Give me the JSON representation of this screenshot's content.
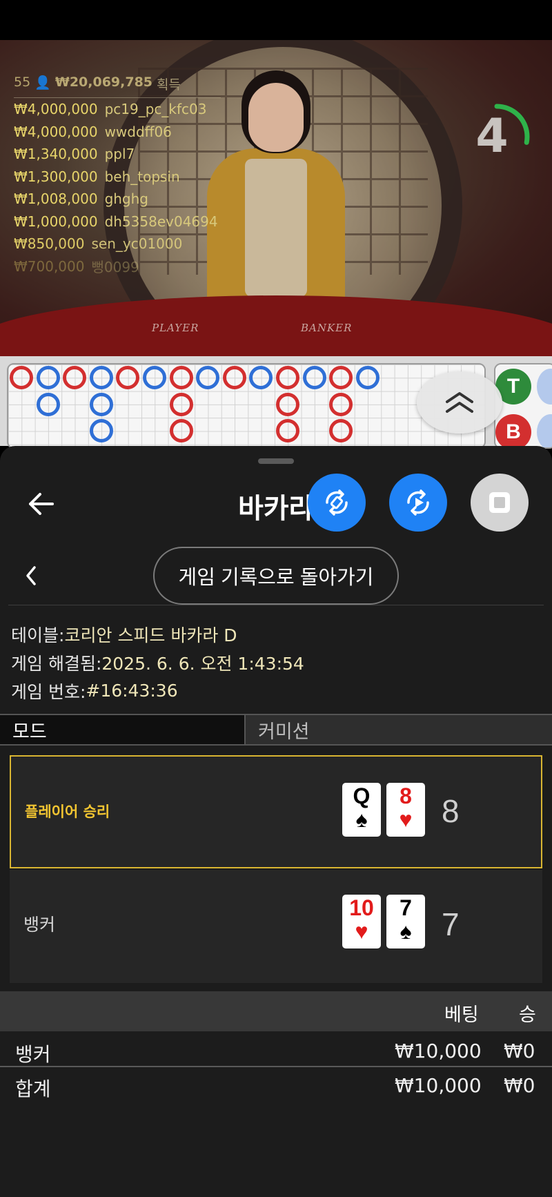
{
  "live_feed": {
    "summary_count": "55",
    "summary_amount": "₩20,069,785",
    "summary_label": "획득",
    "winners": [
      {
        "amount": "₩4,000,000",
        "name": "pc19_pc_kfc03"
      },
      {
        "amount": "₩4,000,000",
        "name": "wwddff06"
      },
      {
        "amount": "₩1,340,000",
        "name": "ppl7"
      },
      {
        "amount": "₩1,300,000",
        "name": "beh_topsin"
      },
      {
        "amount": "₩1,008,000",
        "name": "ghghg"
      },
      {
        "amount": "₩1,000,000",
        "name": "dh5358ev04694"
      },
      {
        "amount": "₩850,000",
        "name": "sen_yc01000"
      },
      {
        "amount": "₩700,000",
        "name": "뻥0099"
      }
    ]
  },
  "video": {
    "table_labels": {
      "player": "PLAYER",
      "banker": "BANKER"
    },
    "countdown": "4",
    "countdown_remaining_fraction": 0.28
  },
  "roadmap": {
    "columns": [
      [
        "B"
      ],
      [
        "P",
        "P"
      ],
      [
        "B"
      ],
      [
        "P",
        "P",
        "P"
      ],
      [
        "B"
      ],
      [
        "P"
      ],
      [
        "B",
        "B",
        "B"
      ],
      [
        "P"
      ],
      [
        "B"
      ],
      [
        "P"
      ],
      [
        "B",
        "B",
        "B"
      ],
      [
        "P"
      ],
      [
        "B",
        "B",
        "B"
      ],
      [
        "P"
      ]
    ],
    "side_chips": {
      "tie": "T",
      "banker": "B"
    }
  },
  "sheet": {
    "title": "바카라",
    "history_button": "게임 기록으로 돌아가기",
    "info": {
      "table_label": "테이블: ",
      "table_value": "코리안 스피드 바카라 D",
      "resolved_label": "게임 해결됨: ",
      "resolved_value": "2025. 6. 6. 오전 1:43:54",
      "number_label": "게임 번호: ",
      "number_value": "#16:43:36"
    },
    "tabs": {
      "mode": "모드",
      "commission": "커미션"
    },
    "results": {
      "player": {
        "label": "플레이어 승리",
        "score": "8",
        "cards": [
          {
            "rank": "Q",
            "suit": "♠",
            "color": "black"
          },
          {
            "rank": "8",
            "suit": "♥",
            "color": "red"
          }
        ]
      },
      "banker": {
        "label": "뱅커",
        "score": "7",
        "cards": [
          {
            "rank": "10",
            "suit": "♥",
            "color": "red"
          },
          {
            "rank": "7",
            "suit": "♠",
            "color": "black"
          }
        ]
      }
    },
    "bets": {
      "headers": {
        "bet": "베팅",
        "win": "승"
      },
      "rows": [
        {
          "name": "뱅커",
          "bet": "₩10,000",
          "win": "₩0"
        },
        {
          "name": "합계",
          "bet": "₩10,000",
          "win": "₩0"
        }
      ]
    }
  },
  "colors": {
    "accent_blue": "#1f82f5",
    "banker_red": "#d32f2f",
    "player_blue": "#2f6fd6",
    "tie_green": "#2e8b3b",
    "winner_gold": "#d9b531",
    "timer_green": "#2fb24a"
  }
}
